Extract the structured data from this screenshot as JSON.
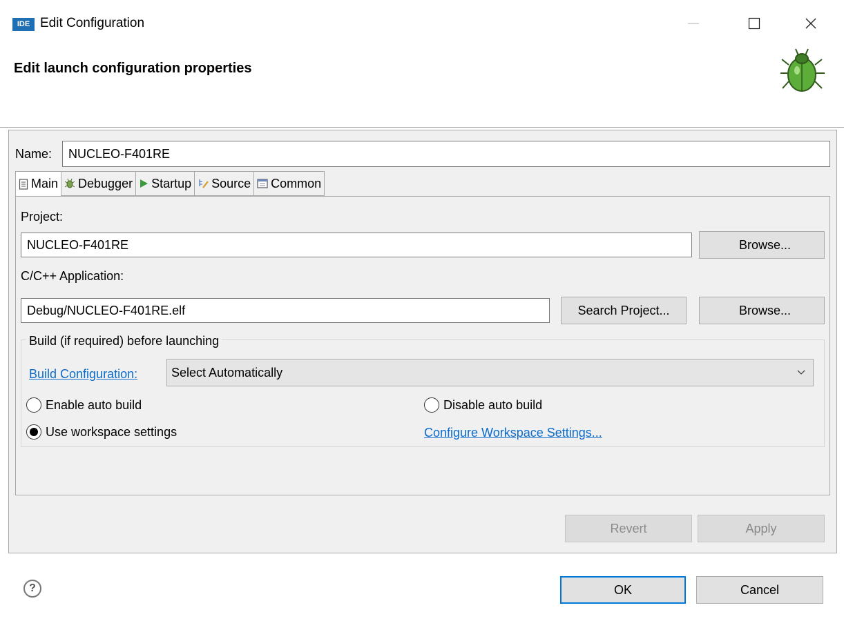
{
  "window": {
    "logo_text": "IDE",
    "title": "Edit Configuration",
    "minimize_icon": "minimize-icon",
    "maximize_icon": "maximize-icon",
    "close_icon": "close-icon"
  },
  "header": {
    "title": "Edit launch configuration properties",
    "icon": "bug-icon"
  },
  "name_field": {
    "label": "Name:",
    "value": "NUCLEO-F401RE"
  },
  "tabs": [
    {
      "label": "Main",
      "icon": "document-icon",
      "active": true
    },
    {
      "label": "Debugger",
      "icon": "debugger-icon",
      "active": false
    },
    {
      "label": "Startup",
      "icon": "play-icon",
      "active": false
    },
    {
      "label": "Source",
      "icon": "source-icon",
      "active": false
    },
    {
      "label": "Common",
      "icon": "common-icon",
      "active": false
    }
  ],
  "main_tab": {
    "project_label": "Project:",
    "project_value": "NUCLEO-F401RE",
    "project_browse": "Browse...",
    "app_label": "C/C++ Application:",
    "app_value": "Debug/NUCLEO-F401RE.elf",
    "search_project": "Search Project...",
    "app_browse": "Browse...",
    "build_group": {
      "legend": "Build (if required) before launching",
      "config_link": "Build Configuration:",
      "config_value": "Select Automatically",
      "enable_auto": "Enable auto build",
      "disable_auto": "Disable auto build",
      "use_workspace": "Use workspace settings",
      "configure_link": "Configure Workspace Settings...",
      "selected": "use_workspace"
    }
  },
  "panel_buttons": {
    "revert": "Revert",
    "apply": "Apply"
  },
  "footer": {
    "help_icon": "help-icon",
    "ok": "OK",
    "cancel": "Cancel"
  },
  "colors": {
    "accent": "#0078d7",
    "link": "#0b6bcb",
    "logo_bg": "#1f6fb5"
  }
}
